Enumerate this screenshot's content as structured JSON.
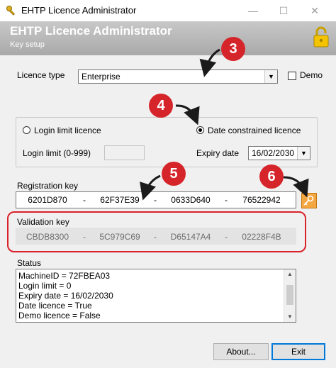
{
  "window": {
    "title": "EHTP Licence Administrator",
    "minimize_glyph": "—",
    "maximize_glyph": "☐",
    "close_glyph": "✕"
  },
  "header": {
    "title": "EHTP Licence Administrator",
    "subtitle": "Key setup",
    "icon": "padlock-icon"
  },
  "licence_type": {
    "label": "Licence type",
    "selected": "Enterprise",
    "demo_label": "Demo",
    "demo_checked": false
  },
  "licence_mode": {
    "login_limit_label": "Login limit licence",
    "date_constrained_label": "Date constrained licence",
    "selected": "date_constrained",
    "login_limit_field_label": "Login limit (0-999)",
    "login_limit_value": "",
    "expiry_label": "Expiry date",
    "expiry_value": "16/02/2030"
  },
  "registration": {
    "label": "Registration key",
    "parts": [
      "6201D870",
      "62F37E39",
      "0633D640",
      "76522942"
    ],
    "separator": "-",
    "wizard_icon": "key-wand-icon"
  },
  "validation": {
    "label": "Validation key",
    "parts": [
      "CBDB8300",
      "5C979C69",
      "D65147A4",
      "02228F4B"
    ],
    "separator": "-"
  },
  "status": {
    "label": "Status",
    "lines": [
      "MachineID = 72FBEA03",
      "Login limit = 0",
      "Expiry date = 16/02/2030",
      "Date licence = True",
      "Demo licence = False"
    ]
  },
  "buttons": {
    "about": "About...",
    "exit": "Exit"
  },
  "annotations": {
    "badges": [
      "3",
      "4",
      "5",
      "6"
    ],
    "badge_color": "#d6252a"
  },
  "colors": {
    "header_gradient_top": "#c8c8c8",
    "header_gradient_bottom": "#a9a9a9",
    "accent": "#0078d7",
    "annotation_red": "#d9222a"
  }
}
